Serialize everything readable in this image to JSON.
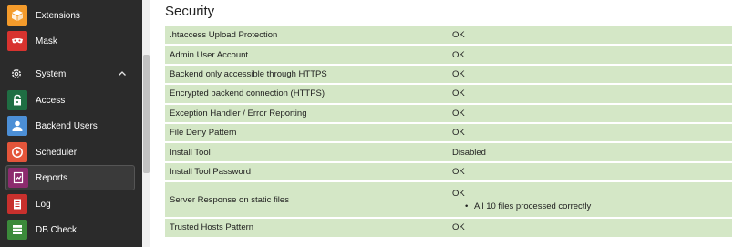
{
  "sidebar": {
    "items": [
      {
        "label": "Extensions",
        "icon": "extensions-icon",
        "color": "#f49b2b"
      },
      {
        "label": "Mask",
        "icon": "mask-icon",
        "color": "#d8332f"
      },
      {
        "label": "System",
        "icon": "gear-icon",
        "group": true
      },
      {
        "label": "Access",
        "icon": "lock-icon",
        "color": "#1f6e43"
      },
      {
        "label": "Backend Users",
        "icon": "user-icon",
        "color": "#4c8fd6"
      },
      {
        "label": "Scheduler",
        "icon": "scheduler-icon",
        "color": "#e4553a"
      },
      {
        "label": "Reports",
        "icon": "reports-icon",
        "color": "#8c2b6e",
        "active": true
      },
      {
        "label": "Log",
        "icon": "log-icon",
        "color": "#c8302d"
      },
      {
        "label": "DB Check",
        "icon": "db-icon",
        "color": "#3b8a3a"
      }
    ]
  },
  "main": {
    "title": "Security",
    "rows": [
      {
        "name": ".htaccess Upload Protection",
        "status": "OK"
      },
      {
        "name": "Admin User Account",
        "status": "OK"
      },
      {
        "name": "Backend only accessible through HTTPS",
        "status": "OK"
      },
      {
        "name": "Encrypted backend connection (HTTPS)",
        "status": "OK"
      },
      {
        "name": "Exception Handler / Error Reporting",
        "status": "OK"
      },
      {
        "name": "File Deny Pattern",
        "status": "OK"
      },
      {
        "name": "Install Tool",
        "status": "Disabled"
      },
      {
        "name": "Install Tool Password",
        "status": "OK"
      },
      {
        "name": "Server Response on static files",
        "status": "OK",
        "details": [
          "All 10 files processed correctly"
        ]
      },
      {
        "name": "Trusted Hosts Pattern",
        "status": "OK"
      }
    ]
  },
  "colors": {
    "sidebar_bg": "#2b2b2b",
    "ok_row_bg": "#d4e7c6"
  }
}
